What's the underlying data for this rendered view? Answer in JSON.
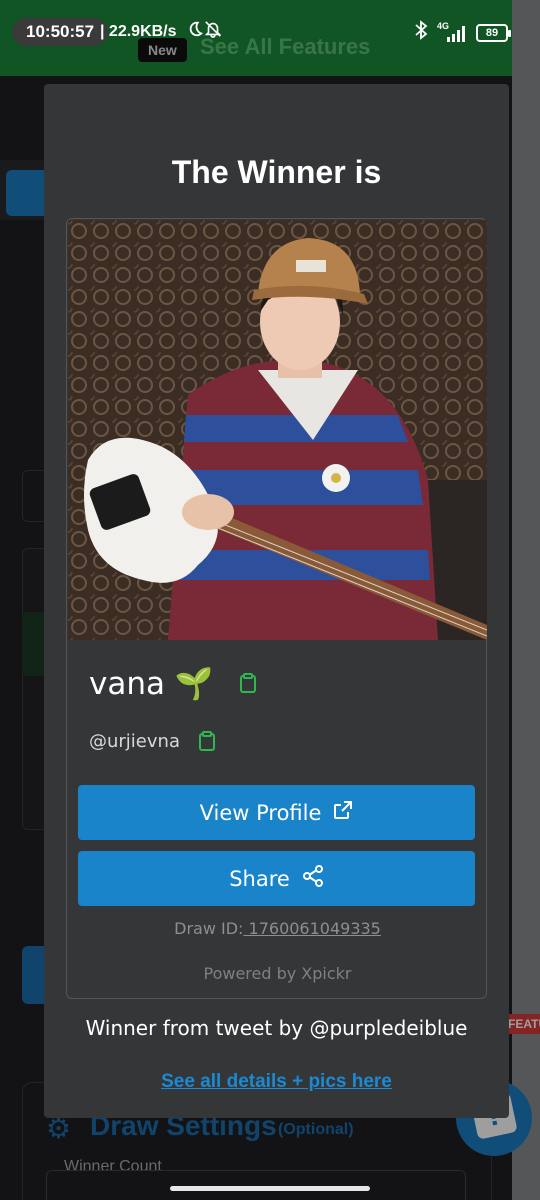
{
  "status_bar": {
    "time": "10:50:57",
    "net_speed": "| 22.9KB/s",
    "network_label": "4G",
    "battery": "89"
  },
  "background": {
    "banner_badge": "New",
    "banner_text": "See All Features",
    "draw_settings_title": "Draw Settings",
    "draw_settings_optional": "(Optional)",
    "winner_count_label": "Winner Count",
    "feature_tag": "FEATUR"
  },
  "modal": {
    "title": "The Winner is",
    "winner": {
      "name": "vana 🌱",
      "handle": "@urjievna"
    },
    "view_profile_label": "View Profile",
    "share_label": "Share",
    "draw_id_label": "Draw ID:",
    "draw_id_value": " 1760061049335",
    "powered_by": "Powered by Xpickr",
    "tweet_source": "Winner from tweet by @purpledeiblue",
    "details_link": "See all details + pics here"
  },
  "colors": {
    "modal_bg": "#353638",
    "primary_button": "#1984c9",
    "link": "#1a8ad4",
    "clipboard_icon": "#2fb84f"
  },
  "icons": {
    "copy": "clipboard-icon",
    "external": "external-link-icon",
    "share": "share-icon"
  }
}
